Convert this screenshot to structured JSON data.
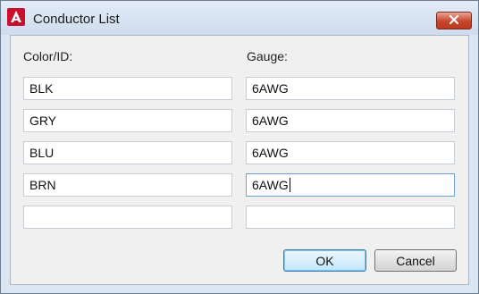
{
  "window": {
    "title": "Conductor List",
    "accent_color": "#c8452d"
  },
  "headers": {
    "color_id": "Color/ID:",
    "gauge": "Gauge:"
  },
  "rows": [
    {
      "color_id": "BLK",
      "gauge": "6AWG"
    },
    {
      "color_id": "GRY",
      "gauge": "6AWG"
    },
    {
      "color_id": "BLU",
      "gauge": "6AWG"
    },
    {
      "color_id": "BRN",
      "gauge": "6AWG"
    },
    {
      "color_id": "",
      "gauge": ""
    }
  ],
  "buttons": {
    "ok": "OK",
    "cancel": "Cancel"
  }
}
